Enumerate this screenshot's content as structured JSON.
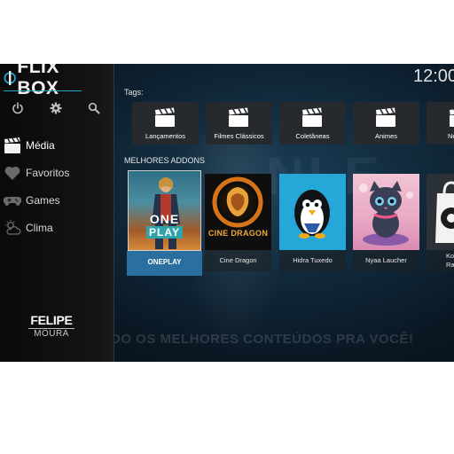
{
  "app": {
    "logo_text": "FLIX BOX",
    "clock": "12:00"
  },
  "top_icons": [
    "power-icon",
    "gear-icon",
    "search-icon"
  ],
  "sidebar": {
    "items": [
      {
        "label": "Média",
        "icon": "movie-clapper-icon",
        "active": true
      },
      {
        "label": "Favoritos",
        "icon": "heart-icon",
        "active": false
      },
      {
        "label": "Games",
        "icon": "gamepad-icon",
        "active": false
      },
      {
        "label": "Clima",
        "icon": "weather-icon",
        "active": false
      }
    ],
    "footer": {
      "line1": "FELIPE",
      "line2": "MOURA"
    }
  },
  "tags": {
    "heading": "Tags:",
    "items": [
      "Lançamentos",
      "Filmes Clássicos",
      "Coletâneas",
      "Animes",
      "Ne"
    ]
  },
  "addons": {
    "heading": "MELHORES ADDONS",
    "items": [
      {
        "label": "ONEPLAY",
        "art_text": "ONE",
        "art_text2": "PLAY",
        "focused": true
      },
      {
        "label": "Cine Dragon",
        "art_text": "CINE DRAGON"
      },
      {
        "label": "Hidra Tuxedo"
      },
      {
        "label": "Nyaa Laucher"
      },
      {
        "label": "Kodi Ra"
      }
    ]
  },
  "background": {
    "tagline": "DO OS MELHORES CONTEÚDOS PRA VOCÊ!",
    "letters": "NLE"
  },
  "colors": {
    "accent": "#2a6fa0",
    "logo_line": "#2aa7c9",
    "background": "#112a3c"
  }
}
